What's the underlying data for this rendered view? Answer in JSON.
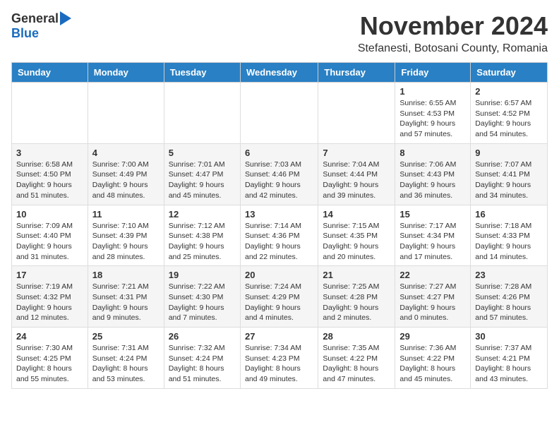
{
  "logo": {
    "general": "General",
    "blue": "Blue"
  },
  "title": "November 2024",
  "location": "Stefanesti, Botosani County, Romania",
  "days_of_week": [
    "Sunday",
    "Monday",
    "Tuesday",
    "Wednesday",
    "Thursday",
    "Friday",
    "Saturday"
  ],
  "weeks": [
    [
      {
        "day": "",
        "info": ""
      },
      {
        "day": "",
        "info": ""
      },
      {
        "day": "",
        "info": ""
      },
      {
        "day": "",
        "info": ""
      },
      {
        "day": "",
        "info": ""
      },
      {
        "day": "1",
        "info": "Sunrise: 6:55 AM\nSunset: 4:53 PM\nDaylight: 9 hours\nand 57 minutes."
      },
      {
        "day": "2",
        "info": "Sunrise: 6:57 AM\nSunset: 4:52 PM\nDaylight: 9 hours\nand 54 minutes."
      }
    ],
    [
      {
        "day": "3",
        "info": "Sunrise: 6:58 AM\nSunset: 4:50 PM\nDaylight: 9 hours\nand 51 minutes."
      },
      {
        "day": "4",
        "info": "Sunrise: 7:00 AM\nSunset: 4:49 PM\nDaylight: 9 hours\nand 48 minutes."
      },
      {
        "day": "5",
        "info": "Sunrise: 7:01 AM\nSunset: 4:47 PM\nDaylight: 9 hours\nand 45 minutes."
      },
      {
        "day": "6",
        "info": "Sunrise: 7:03 AM\nSunset: 4:46 PM\nDaylight: 9 hours\nand 42 minutes."
      },
      {
        "day": "7",
        "info": "Sunrise: 7:04 AM\nSunset: 4:44 PM\nDaylight: 9 hours\nand 39 minutes."
      },
      {
        "day": "8",
        "info": "Sunrise: 7:06 AM\nSunset: 4:43 PM\nDaylight: 9 hours\nand 36 minutes."
      },
      {
        "day": "9",
        "info": "Sunrise: 7:07 AM\nSunset: 4:41 PM\nDaylight: 9 hours\nand 34 minutes."
      }
    ],
    [
      {
        "day": "10",
        "info": "Sunrise: 7:09 AM\nSunset: 4:40 PM\nDaylight: 9 hours\nand 31 minutes."
      },
      {
        "day": "11",
        "info": "Sunrise: 7:10 AM\nSunset: 4:39 PM\nDaylight: 9 hours\nand 28 minutes."
      },
      {
        "day": "12",
        "info": "Sunrise: 7:12 AM\nSunset: 4:38 PM\nDaylight: 9 hours\nand 25 minutes."
      },
      {
        "day": "13",
        "info": "Sunrise: 7:14 AM\nSunset: 4:36 PM\nDaylight: 9 hours\nand 22 minutes."
      },
      {
        "day": "14",
        "info": "Sunrise: 7:15 AM\nSunset: 4:35 PM\nDaylight: 9 hours\nand 20 minutes."
      },
      {
        "day": "15",
        "info": "Sunrise: 7:17 AM\nSunset: 4:34 PM\nDaylight: 9 hours\nand 17 minutes."
      },
      {
        "day": "16",
        "info": "Sunrise: 7:18 AM\nSunset: 4:33 PM\nDaylight: 9 hours\nand 14 minutes."
      }
    ],
    [
      {
        "day": "17",
        "info": "Sunrise: 7:19 AM\nSunset: 4:32 PM\nDaylight: 9 hours\nand 12 minutes."
      },
      {
        "day": "18",
        "info": "Sunrise: 7:21 AM\nSunset: 4:31 PM\nDaylight: 9 hours\nand 9 minutes."
      },
      {
        "day": "19",
        "info": "Sunrise: 7:22 AM\nSunset: 4:30 PM\nDaylight: 9 hours\nand 7 minutes."
      },
      {
        "day": "20",
        "info": "Sunrise: 7:24 AM\nSunset: 4:29 PM\nDaylight: 9 hours\nand 4 minutes."
      },
      {
        "day": "21",
        "info": "Sunrise: 7:25 AM\nSunset: 4:28 PM\nDaylight: 9 hours\nand 2 minutes."
      },
      {
        "day": "22",
        "info": "Sunrise: 7:27 AM\nSunset: 4:27 PM\nDaylight: 9 hours\nand 0 minutes."
      },
      {
        "day": "23",
        "info": "Sunrise: 7:28 AM\nSunset: 4:26 PM\nDaylight: 8 hours\nand 57 minutes."
      }
    ],
    [
      {
        "day": "24",
        "info": "Sunrise: 7:30 AM\nSunset: 4:25 PM\nDaylight: 8 hours\nand 55 minutes."
      },
      {
        "day": "25",
        "info": "Sunrise: 7:31 AM\nSunset: 4:24 PM\nDaylight: 8 hours\nand 53 minutes."
      },
      {
        "day": "26",
        "info": "Sunrise: 7:32 AM\nSunset: 4:24 PM\nDaylight: 8 hours\nand 51 minutes."
      },
      {
        "day": "27",
        "info": "Sunrise: 7:34 AM\nSunset: 4:23 PM\nDaylight: 8 hours\nand 49 minutes."
      },
      {
        "day": "28",
        "info": "Sunrise: 7:35 AM\nSunset: 4:22 PM\nDaylight: 8 hours\nand 47 minutes."
      },
      {
        "day": "29",
        "info": "Sunrise: 7:36 AM\nSunset: 4:22 PM\nDaylight: 8 hours\nand 45 minutes."
      },
      {
        "day": "30",
        "info": "Sunrise: 7:37 AM\nSunset: 4:21 PM\nDaylight: 8 hours\nand 43 minutes."
      }
    ]
  ]
}
